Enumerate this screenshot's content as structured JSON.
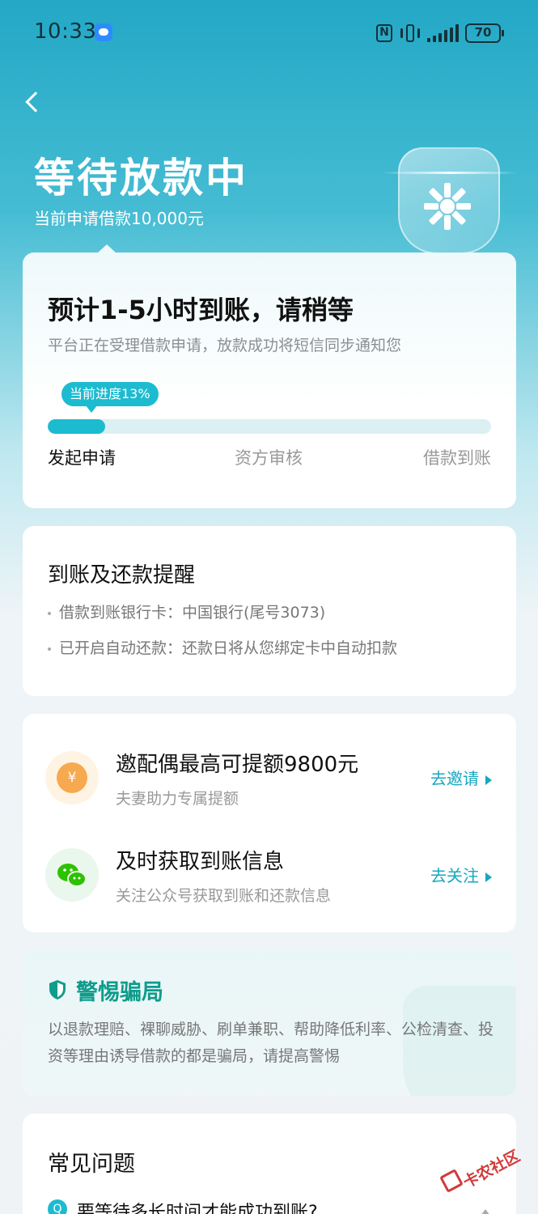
{
  "status_bar": {
    "time": "10:33",
    "battery": "70",
    "nfc_glyph": "N",
    "icons": [
      "message-icon",
      "nfc-icon",
      "vibrate-icon",
      "signal-icon",
      "battery-icon"
    ]
  },
  "header": {
    "back_icon": "back-chevron-icon",
    "title": "等待放款中",
    "subtitle": "当前申请借款10,000元",
    "graphic_icon": "bank-shield-icon"
  },
  "progress_card": {
    "title": "预计1-5小时到账，请稍等",
    "description": "平台正在受理借款申请，放款成功将短信同步通知您",
    "badge": "当前进度13%",
    "progress_percent": 13,
    "steps": [
      "发起申请",
      "资方审核",
      "借款到账"
    ]
  },
  "reminder_card": {
    "title": "到账及还款提醒",
    "items": [
      "借款到账银行卡：中国银行(尾号3073)",
      "已开启自动还款：还款日将从您绑定卡中自动扣款"
    ]
  },
  "promo_card": {
    "rows": [
      {
        "icon": "yuan-coin-icon",
        "coin_glyph": "¥",
        "title": "邀配偶最高可提额9800元",
        "subtitle": "夫妻助力专属提额",
        "action": "去邀请"
      },
      {
        "icon": "wechat-icon",
        "title": "及时获取到账信息",
        "subtitle": "关注公众号获取到账和还款信息",
        "action": "去关注"
      }
    ]
  },
  "warning_card": {
    "icon": "shield-check-icon",
    "title": "警惕骗局",
    "text": "以退款理赔、裸聊威胁、刷单兼职、帮助降低利率、公检清查、投资等理由诱导借款的都是骗局，请提高警惕"
  },
  "faq_card": {
    "title": "常见问题",
    "question_badge": "Q",
    "first_question": "要等待多长时间才能成功到账?"
  },
  "watermark": {
    "text": "卡农社区"
  },
  "colors": {
    "accent": "#1dbbd0",
    "action_text": "#17a7bf",
    "warning_green": "#0e9c8c",
    "header_gradient_top": "#23a8c6"
  }
}
